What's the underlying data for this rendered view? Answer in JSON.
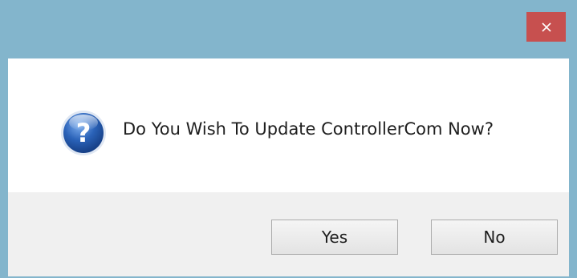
{
  "window": {
    "title": "",
    "close_glyph": "×"
  },
  "dialog": {
    "message": "Do You Wish To Update ControllerCom Now?",
    "icon": "question-icon"
  },
  "buttons": {
    "yes_label": "Yes",
    "no_label": "No"
  },
  "colors": {
    "titlebar": "#83b5cc",
    "close_button": "#c7504f",
    "button_bar": "#f0f0f0",
    "icon_blue": "#2a62b8"
  }
}
